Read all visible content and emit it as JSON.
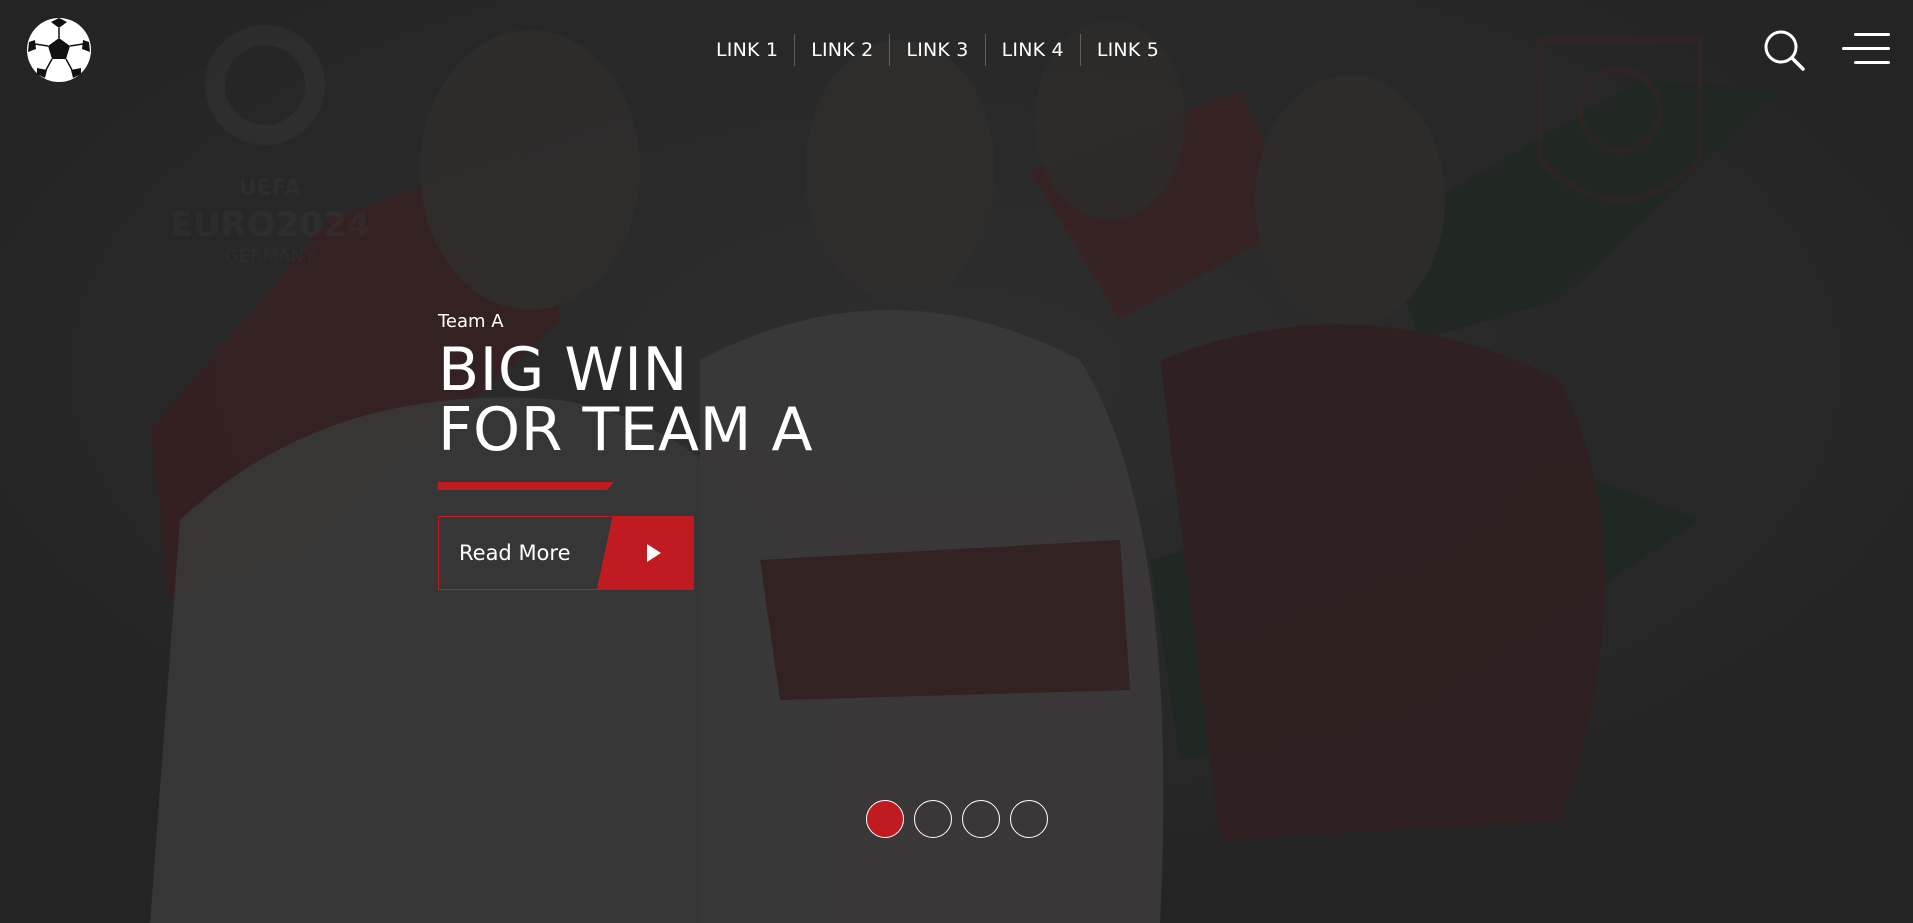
{
  "header": {
    "logo": {
      "icon": "soccer-ball-icon"
    },
    "nav": {
      "links": [
        {
          "label": "LINK 1"
        },
        {
          "label": "LINK 2"
        },
        {
          "label": "LINK 3"
        },
        {
          "label": "LINK 4"
        },
        {
          "label": "LINK 5"
        }
      ]
    },
    "search_icon": "search-icon",
    "menu_icon": "hamburger-menu-icon"
  },
  "hero": {
    "kicker": "Team A",
    "headline_line1": "BIG WIN",
    "headline_line2": "FOR TEAM A",
    "cta": {
      "label": "Read More",
      "icon": "play-arrow-icon"
    },
    "background_watermark_text": [
      "UEFA",
      "EURO2024",
      "GERMANY"
    ]
  },
  "slider": {
    "total_slides": 4,
    "active_index": 0
  },
  "colors": {
    "accent": "#c11b22",
    "background": "#2b2b2b",
    "text": "#ffffff"
  }
}
